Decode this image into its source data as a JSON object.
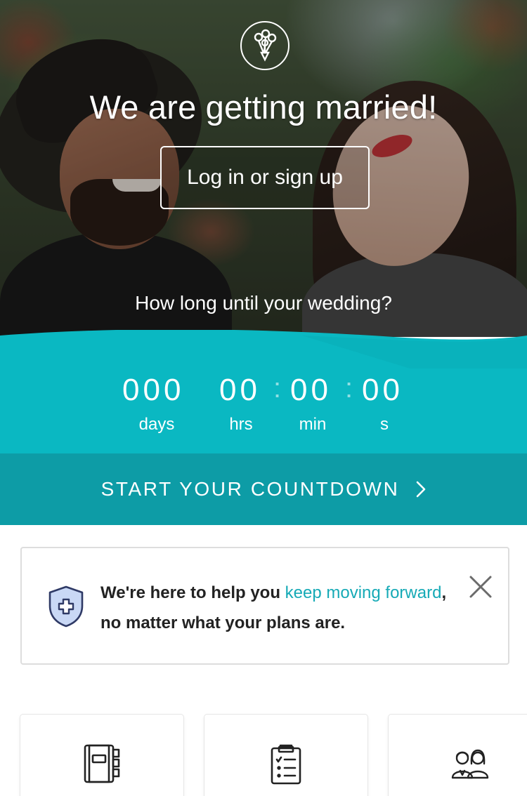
{
  "hero": {
    "title": "We are getting married!",
    "login_label": "Log in or sign up",
    "question": "How long until your wedding?"
  },
  "countdown": {
    "days": "000",
    "hours": "00",
    "minutes": "00",
    "seconds": "00",
    "separator": ":",
    "units": {
      "days": "days",
      "hours": "hrs",
      "minutes": "min",
      "seconds": "s"
    },
    "cta_label": "START YOUR COUNTDOWN"
  },
  "notice": {
    "text_before": "We're here to help you ",
    "link_text_line1": "keep moving",
    "link_text_line2": "forward",
    "text_after": ", no matter what your plans are."
  },
  "tools": [
    {
      "icon": "planner-notebook-icon"
    },
    {
      "icon": "checklist-clipboard-icon"
    },
    {
      "icon": "couple-guests-icon"
    }
  ],
  "colors": {
    "teal": "#0ab8c2",
    "teal_dark": "#0d9ca6",
    "link": "#16aab6",
    "shield_fill": "#c9d8f5",
    "shield_stroke": "#2f3a66"
  }
}
